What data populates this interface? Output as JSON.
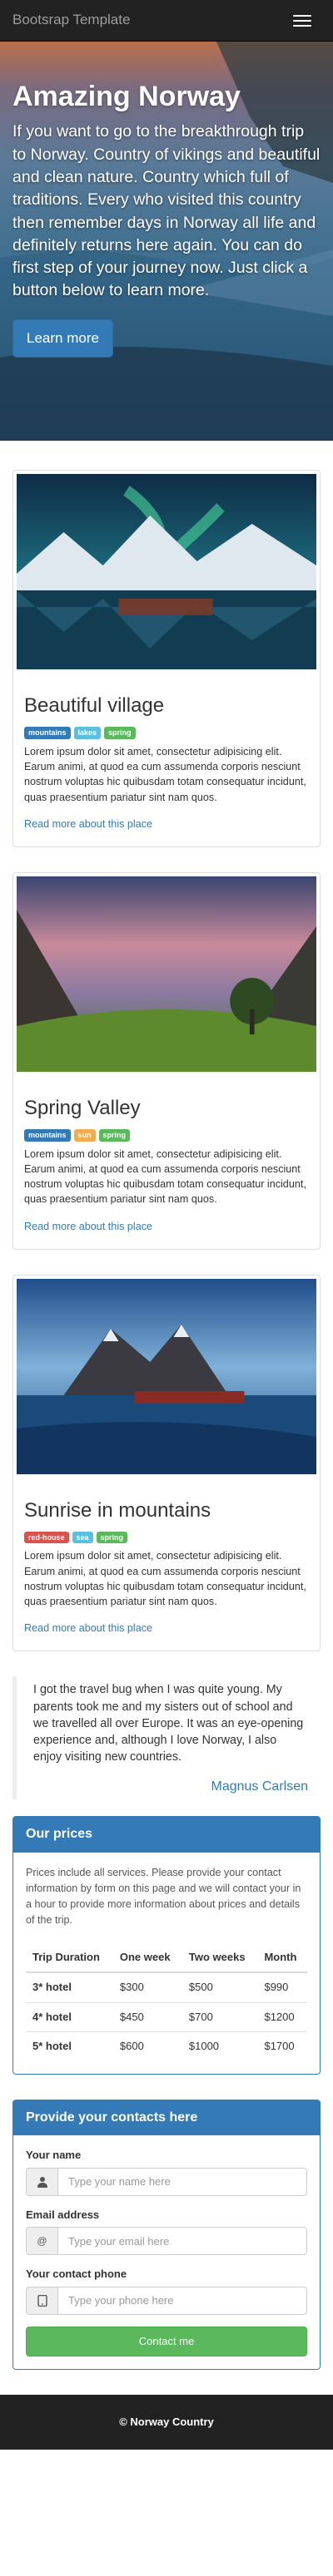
{
  "navbar": {
    "brand": "Bootsrap Template",
    "menu_icon": "hamburger-icon"
  },
  "hero": {
    "title": "Amazing Norway",
    "text": "If you want to go to the breakthrough trip to Norway. Country of vikings and beautiful and clean nature. Country which full of traditions. Every who visited this country then remember days in Norway all life and definitely returns here again. You can do first step of your journey now. Just click a button below to learn more.",
    "button": "Learn more"
  },
  "cards": [
    {
      "title": "Beautiful village",
      "labels": [
        {
          "text": "mountains",
          "color": "#337ab7"
        },
        {
          "text": "lakes",
          "color": "#5bc0de"
        },
        {
          "text": "spring",
          "color": "#5cb85c"
        }
      ],
      "text": "Lorem ipsum dolor sit amet, consectetur adipisicing elit. Earum animi, at quod ea cum assumenda corporis nesciunt nostrum voluptas hic quibusdam totam consequatur incidunt, quas praesentium pariatur sint nam quos.",
      "link": "Read more about this place"
    },
    {
      "title": "Spring Valley",
      "labels": [
        {
          "text": "mountains",
          "color": "#337ab7"
        },
        {
          "text": "sun",
          "color": "#f0ad4e"
        },
        {
          "text": "spring",
          "color": "#5cb85c"
        }
      ],
      "text": "Lorem ipsum dolor sit amet, consectetur adipisicing elit. Earum animi, at quod ea cum assumenda corporis nesciunt nostrum voluptas hic quibusdam totam consequatur incidunt, quas praesentium pariatur sint nam quos.",
      "link": "Read more about this place"
    },
    {
      "title": "Sunrise in mountains",
      "labels": [
        {
          "text": "red-house",
          "color": "#d9534f"
        },
        {
          "text": "sea",
          "color": "#5bc0de"
        },
        {
          "text": "spring",
          "color": "#5cb85c"
        }
      ],
      "text": "Lorem ipsum dolor sit amet, consectetur adipisicing elit. Earum animi, at quod ea cum assumenda corporis nesciunt nostrum voluptas hic quibusdam totam consequatur incidunt, quas praesentium pariatur sint nam quos.",
      "link": "Read more about this place"
    }
  ],
  "quote": {
    "text": "I got the travel bug when I was quite young. My parents took me and my sisters out of school and we travelled all over Europe. It was an eye-opening experience and, although I love Norway, I also enjoy visiting new countries.",
    "author": "Magnus Carlsen"
  },
  "prices": {
    "heading": "Our prices",
    "intro": "Prices include all services. Please provide your contact information by form on this page and we will contact your in a hour to provide more information about prices and details of the trip.",
    "columns": [
      "Trip Duration",
      "One week",
      "Two weeks",
      "Month"
    ],
    "rows": [
      [
        "3* hotel",
        "$300",
        "$500",
        "$990"
      ],
      [
        "4* hotel",
        "$450",
        "$700",
        "$1200"
      ],
      [
        "5* hotel",
        "$600",
        "$1000",
        "$1700"
      ]
    ]
  },
  "contact": {
    "heading": "Provide your contacts here",
    "name_label": "Your name",
    "name_placeholder": "Type your name here",
    "email_label": "Email address",
    "email_placeholder": "Type your email here",
    "phone_label": "Your contact phone",
    "phone_placeholder": "Type your phone here",
    "submit": "Contact me"
  },
  "footer": {
    "text": "© Norway Country"
  },
  "colors": {
    "primary": "#337ab7",
    "success": "#5cb85c",
    "navbar": "#222222"
  }
}
